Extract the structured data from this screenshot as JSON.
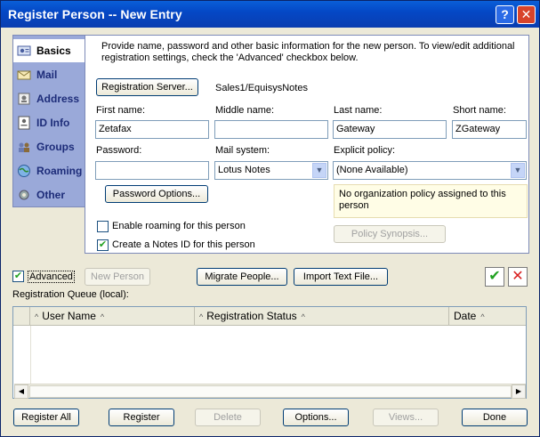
{
  "window": {
    "title": "Register Person -- New Entry",
    "help_label": "?",
    "close_label": "✕"
  },
  "nav": {
    "items": [
      {
        "label": "Basics",
        "icon": "person-card-icon"
      },
      {
        "label": "Mail",
        "icon": "envelope-icon"
      },
      {
        "label": "Address",
        "icon": "address-icon"
      },
      {
        "label": "ID Info",
        "icon": "id-card-icon"
      },
      {
        "label": "Groups",
        "icon": "group-icon"
      },
      {
        "label": "Roaming",
        "icon": "globe-icon"
      },
      {
        "label": "Other",
        "icon": "gear-icon"
      }
    ]
  },
  "panel": {
    "info": "Provide name, password and other basic information for the new person.  To view/edit additional registration settings, check the 'Advanced' checkbox below.",
    "registration_server_button": "Registration Server...",
    "server_name": "Sales1/EquisysNotes",
    "first_name_label": "First name:",
    "first_name_value": "Zetafax",
    "middle_name_label": "Middle name:",
    "middle_name_value": "",
    "last_name_label": "Last name:",
    "last_name_value": "Gateway",
    "short_name_label": "Short name:",
    "short_name_value": "ZGateway",
    "password_label": "Password:",
    "password_value": "",
    "mail_system_label": "Mail system:",
    "mail_system_value": "Lotus Notes",
    "explicit_policy_label": "Explicit policy:",
    "explicit_policy_value": "(None Available)",
    "password_options_button": "Password Options...",
    "policy_note": "No organization policy assigned to this person",
    "enable_roaming_label": "Enable roaming for this person",
    "enable_roaming_checked": false,
    "create_id_label": "Create a Notes ID for this person",
    "create_id_checked": true,
    "policy_synopsis_button": "Policy Synopsis..."
  },
  "toolbar": {
    "advanced_label": "Advanced",
    "advanced_checked": true,
    "new_person_button": "New Person",
    "migrate_button": "Migrate People...",
    "import_button": "Import Text File...",
    "queue_label": "Registration Queue (local):"
  },
  "queue": {
    "columns": [
      "User Name",
      "Registration Status",
      "Date"
    ],
    "rows": []
  },
  "footer": {
    "register_all": "Register All",
    "register": "Register",
    "delete": "Delete",
    "options": "Options...",
    "views": "Views...",
    "done": "Done"
  },
  "colors": {
    "titlebar": "#0448c6",
    "nav_bg": "#9aa9d9",
    "accept": "#21a121",
    "cancel": "#d81e1e"
  }
}
